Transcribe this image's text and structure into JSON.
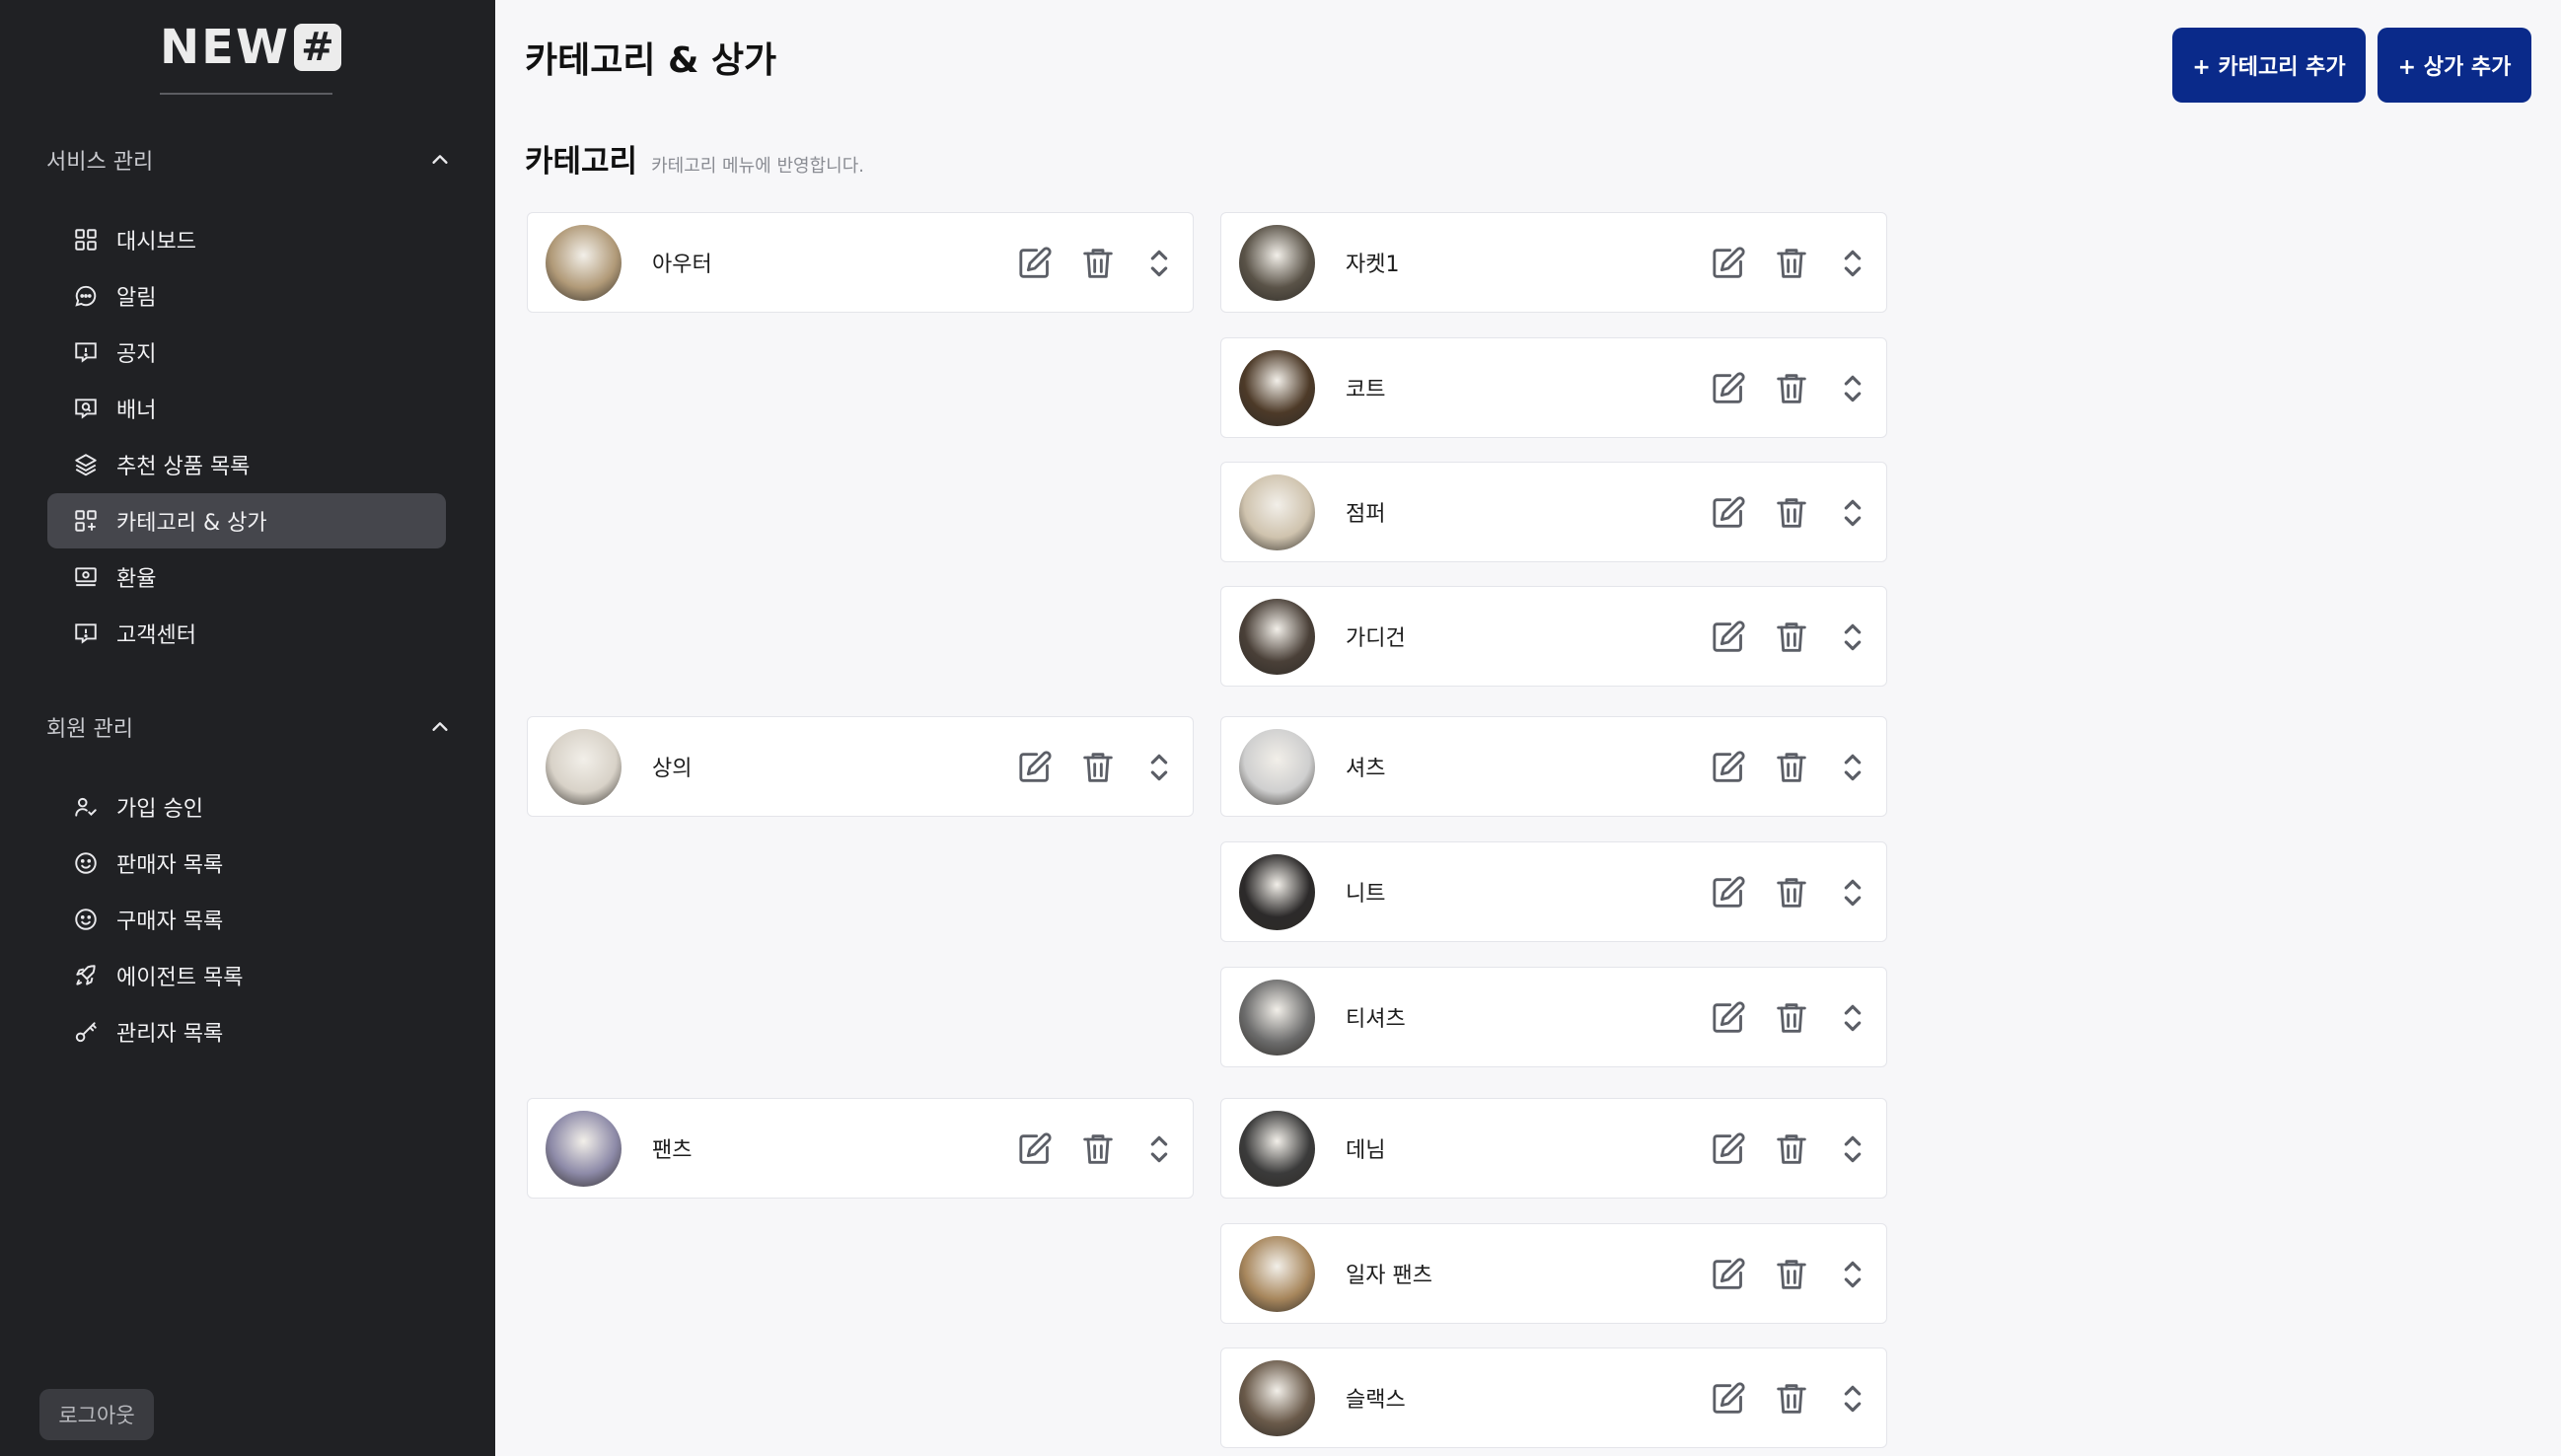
{
  "logo": {
    "text": "NEW",
    "mark": "#"
  },
  "sidebar": {
    "sections": [
      {
        "title": "서비스 관리",
        "items": [
          {
            "label": "대시보드",
            "icon": "grid-icon"
          },
          {
            "label": "알림",
            "icon": "chat-bubble-icon"
          },
          {
            "label": "공지",
            "icon": "notice-icon"
          },
          {
            "label": "배너",
            "icon": "banner-icon"
          },
          {
            "label": "추천 상품 목록",
            "icon": "layers-icon"
          },
          {
            "label": "카테고리 & 상가",
            "icon": "category-grid-icon",
            "active": true
          },
          {
            "label": "환율",
            "icon": "exchange-icon"
          },
          {
            "label": "고객센터",
            "icon": "support-icon"
          }
        ]
      },
      {
        "title": "회원 관리",
        "items": [
          {
            "label": "가입 승인",
            "icon": "user-check-icon"
          },
          {
            "label": "판매자 목록",
            "icon": "smile-icon"
          },
          {
            "label": "구매자 목록",
            "icon": "smile-icon"
          },
          {
            "label": "에이전트 목록",
            "icon": "rocket-icon"
          },
          {
            "label": "관리자 목록",
            "icon": "key-icon"
          }
        ]
      }
    ],
    "logout": "로그아웃"
  },
  "header": {
    "title": "카테고리 & 상가",
    "add_category": "+ 카테고리 추가",
    "add_store": "+ 상가 추가"
  },
  "categories_section": {
    "title": "카테고리",
    "hint": "카테고리 메뉴에 반영합니다."
  },
  "parents": [
    {
      "label": "아우터",
      "color": "#b19a78"
    },
    {
      "label": "상의",
      "color": "#d8d2c8"
    },
    {
      "label": "팬츠",
      "color": "#8d8aa8"
    }
  ],
  "children": [
    {
      "label": "자켓1",
      "color": "#5a5348"
    },
    {
      "label": "코트",
      "color": "#4d3a28"
    },
    {
      "label": "점퍼",
      "color": "#cfc3ae"
    },
    {
      "label": "가디건",
      "color": "#4a4038"
    },
    {
      "label": "셔츠",
      "color": "#cfcfcf"
    },
    {
      "label": "니트",
      "color": "#2c2a2a"
    },
    {
      "label": "티셔츠",
      "color": "#6c6c6c"
    },
    {
      "label": "데님",
      "color": "#3b3b3b"
    },
    {
      "label": "일자 팬츠",
      "color": "#a8875d"
    },
    {
      "label": "슬랙스",
      "color": "#6a5a4a"
    }
  ],
  "colors": {
    "sidebar_bg": "#202124",
    "primary": "#0a2a8a",
    "active_item": "#45464c",
    "page_bg": "#f7f7f9"
  }
}
